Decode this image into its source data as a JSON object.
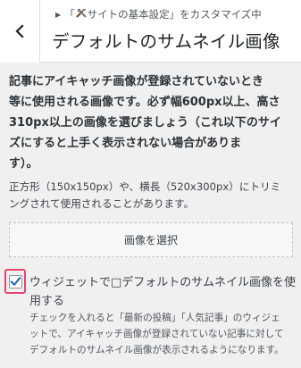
{
  "header": {
    "breadcrumb_prefix": "「",
    "breadcrumb_section": "サイトの基本設定",
    "breadcrumb_suffix": "」をカスタマイズ中",
    "title": "デフォルトのサムネイル画像",
    "back_icon": "chevron-left-icon",
    "section_icon": "tools-icon"
  },
  "description": {
    "bold_lines": [
      "記事にアイキャッチ画像が登録されていないとき",
      "等に使用される画像です。必ず幅600px以上、高さ",
      "310px以上の画像を選びましょう（これ以下のサイ",
      "ズにすると上手く表示されない場合がありま",
      "す）。"
    ],
    "note_lines": [
      "正方形（150x150px）や、横長（520x300px）にトリミ",
      "ングされて使用されることがあります。"
    ]
  },
  "select_button": {
    "label": "画像を選択"
  },
  "widget_option": {
    "checked": true,
    "label_lines": [
      "ウィジェットで□デフォルトのサムネイル画像を使",
      "用する"
    ],
    "desc_lines": [
      "チェックを入れると「最新の投稿」「人気記事」のウィジェ",
      "ットで、アイキャッチ画像が登録されていない記事に対して",
      "デフォルトのサムネイル画像が表示されるようになります。"
    ]
  },
  "colors": {
    "highlight_border": "#e3476d",
    "checkmark": "#2271b1"
  }
}
